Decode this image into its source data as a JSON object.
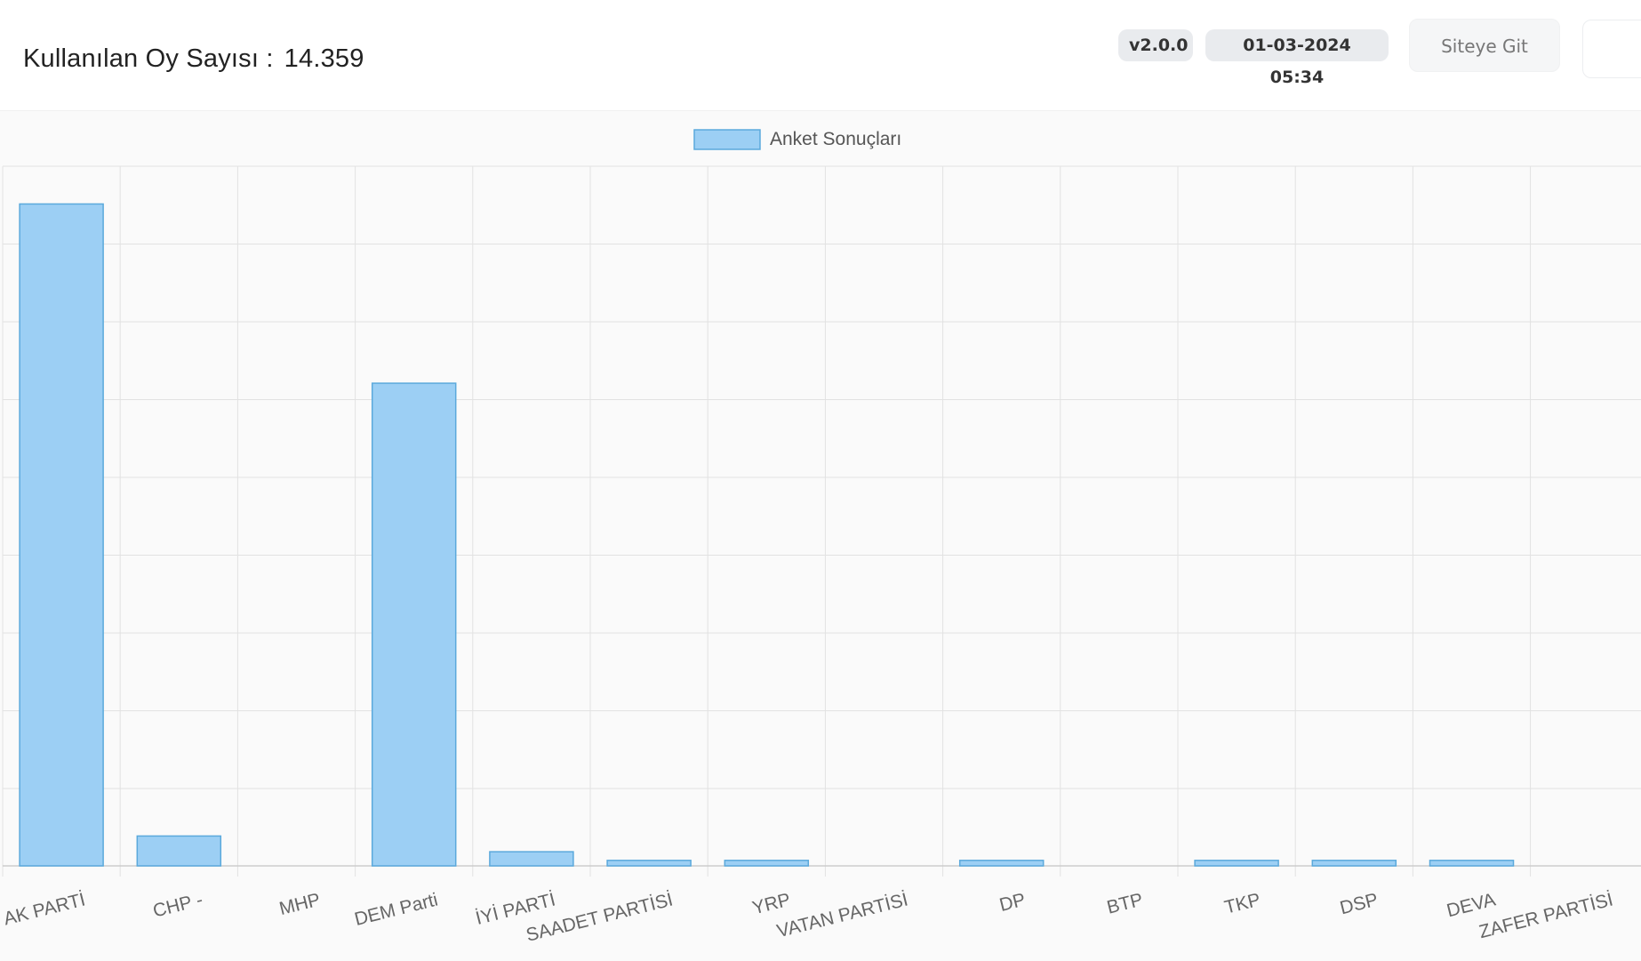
{
  "header": {
    "vote_label": "Kullanılan Oy Sayısı :",
    "vote_value": "14.359",
    "version": "v2.0.0",
    "timestamp": "01-03-2024 05:34",
    "site_button": "Siteye Git"
  },
  "colors": {
    "bar_fill": "#9ccff4",
    "bar_stroke": "#5ba9dc",
    "grid": "#e2e2e2",
    "axis": "#cccccc"
  },
  "chart_data": {
    "type": "bar",
    "title": "",
    "xlabel": "",
    "ylabel": "",
    "legend": "top",
    "grid": true,
    "categories": [
      "AK PARTİ",
      "CHP -",
      "MHP",
      "DEM Parti",
      "İYİ PARTİ",
      "SAADET PARTİSİ",
      "YRP",
      "VATAN PARTİSİ",
      "DP",
      "BTP",
      "TKP",
      "DSP",
      "DEVA",
      "ZAFER PARTİSİ"
    ],
    "series": [
      {
        "name": "Anket Sonuçları",
        "values": [
          8420,
          380,
          0,
          6140,
          180,
          70,
          70,
          0,
          70,
          0,
          70,
          70,
          70,
          0
        ]
      }
    ],
    "ylim": [
      0,
      8900
    ]
  }
}
